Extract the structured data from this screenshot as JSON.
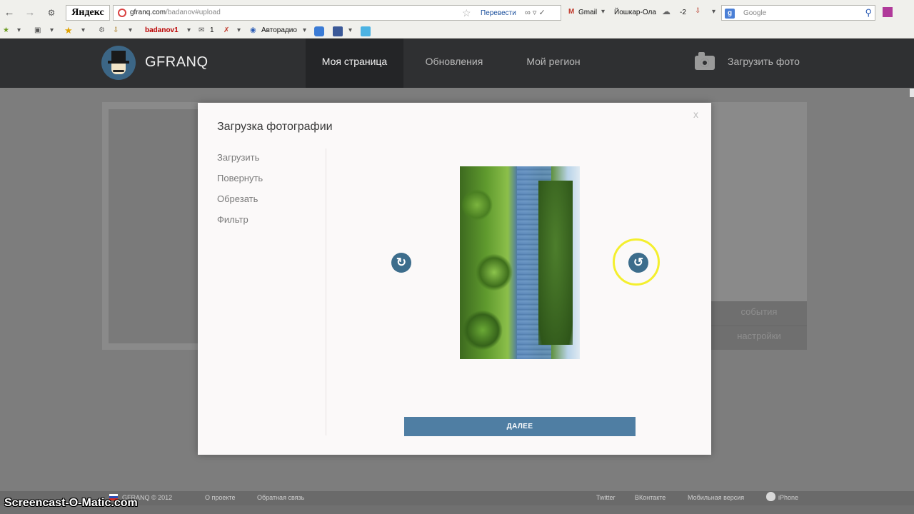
{
  "browser": {
    "yandex_label": "Яндекс",
    "url_host": "gfranq.com",
    "url_path": "/badanov#upload",
    "translate_label": "Перевести",
    "gmail_label": "Gmail",
    "city_label": "Йошкар-Ола",
    "temperature": "-2",
    "search_placeholder": "Google",
    "bookmarks": {
      "user": "badanov1",
      "mail_count": "1",
      "radio": "Авторадио"
    }
  },
  "header": {
    "brand": "GFRANQ",
    "nav": [
      "Моя страница",
      "Обновления",
      "Мой регион"
    ],
    "active_nav": "Моя страница",
    "upload_label": "Загрузить фото"
  },
  "background": {
    "side_menu": [
      "события",
      "настройки"
    ]
  },
  "modal": {
    "title": "Загрузка фотографии",
    "close_label": "x",
    "menu": [
      "Загрузить",
      "Повернуть",
      "Обрезать",
      "Фильтр"
    ],
    "next_label": "ДАЛЕЕ"
  },
  "footer": {
    "copyright": "GFRANQ © 2012",
    "about": "О проекте",
    "feedback": "Обратная связь",
    "twitter": "Twitter",
    "vkontakte": "ВКонтакте",
    "mobile": "Мобильная версия",
    "iphone": "iPhone"
  },
  "watermark": "Screencast-O-Matic.com",
  "colors": {
    "header_bg": "#2f3032",
    "accent": "#4f7ea3",
    "rotate_button": "#3d6d8c",
    "cursor_highlight": "#f4ef2e"
  }
}
